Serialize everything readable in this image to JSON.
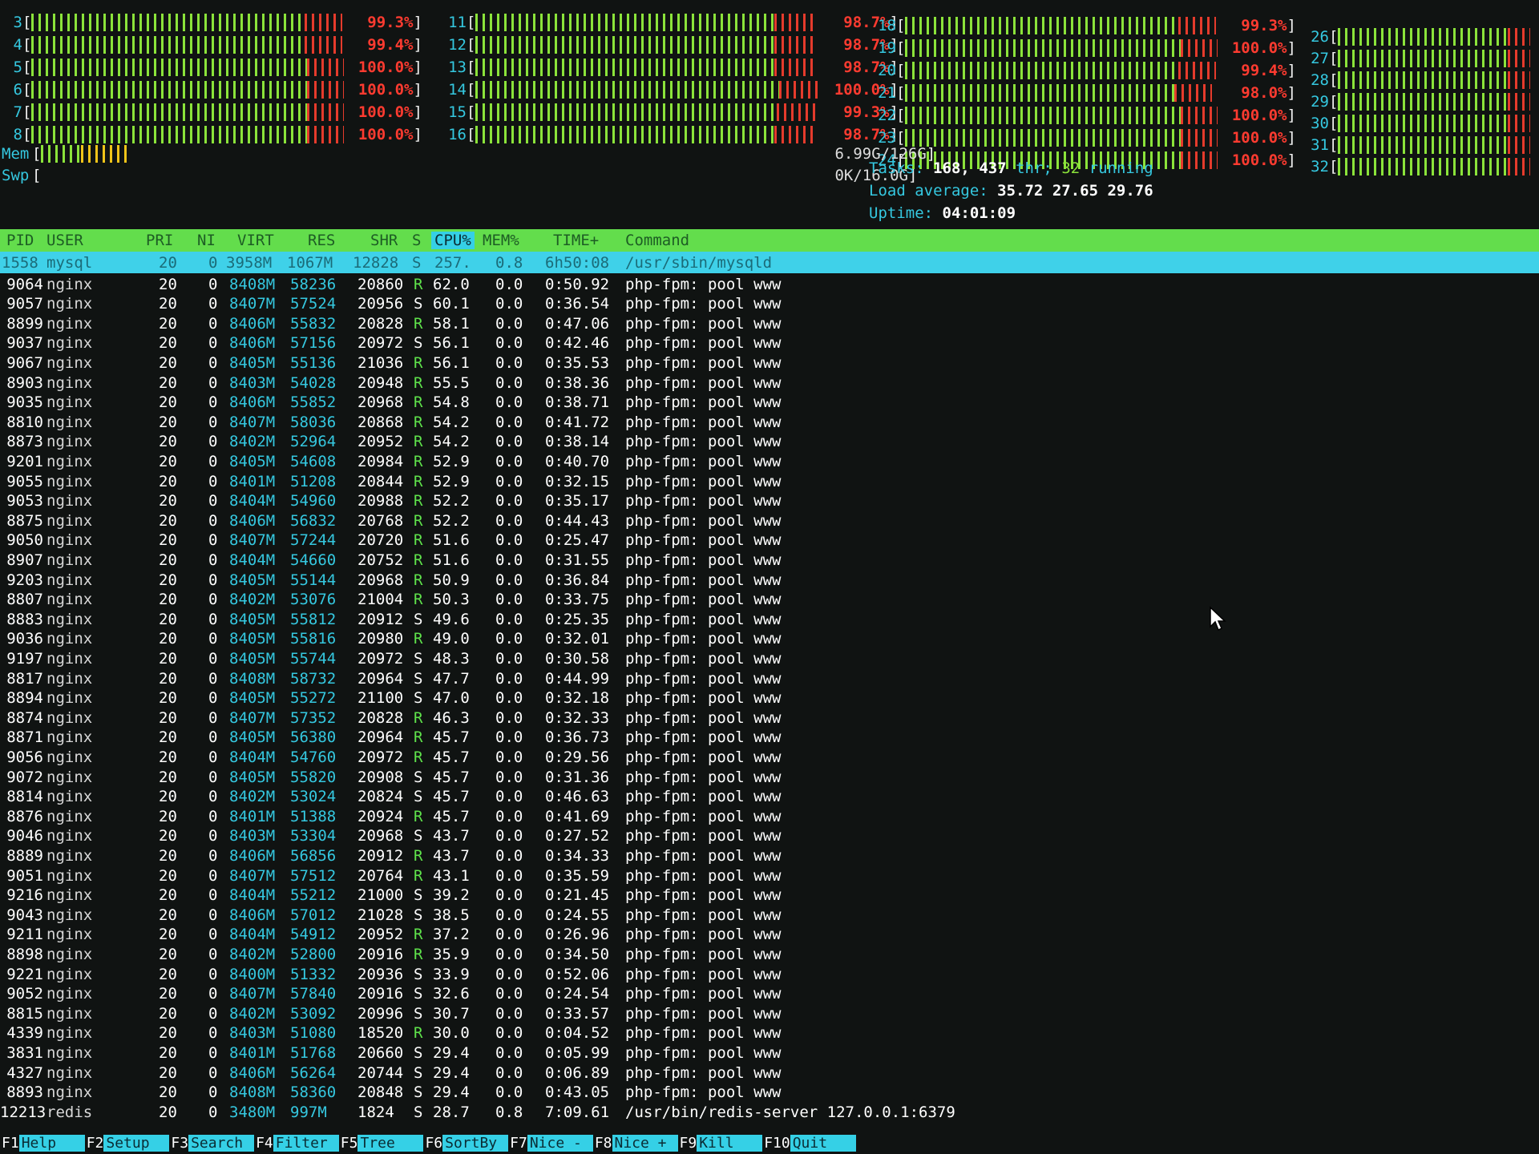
{
  "cpu_meters": [
    {
      "id": "3",
      "pct": "99.3%",
      "value": 0.993
    },
    {
      "id": "4",
      "pct": "99.4%",
      "value": 0.994
    },
    {
      "id": "5",
      "pct": "100.0%",
      "value": 1.0
    },
    {
      "id": "6",
      "pct": "100.0%",
      "value": 1.0
    },
    {
      "id": "7",
      "pct": "100.0%",
      "value": 1.0
    },
    {
      "id": "8",
      "pct": "100.0%",
      "value": 1.0
    },
    {
      "id": "11",
      "pct": "98.7%",
      "value": 0.987
    },
    {
      "id": "12",
      "pct": "98.7%",
      "value": 0.987
    },
    {
      "id": "13",
      "pct": "98.7%",
      "value": 0.987
    },
    {
      "id": "14",
      "pct": "100.0%",
      "value": 1.0
    },
    {
      "id": "15",
      "pct": "99.3%",
      "value": 0.993
    },
    {
      "id": "16",
      "pct": "98.7%",
      "value": 0.987
    },
    {
      "id": "18",
      "pct": "99.3%",
      "value": 0.993
    },
    {
      "id": "19",
      "pct": "100.0%",
      "value": 1.0
    },
    {
      "id": "20",
      "pct": "99.4%",
      "value": 0.994
    },
    {
      "id": "21",
      "pct": "98.0%",
      "value": 0.98
    },
    {
      "id": "22",
      "pct": "100.0%",
      "value": 1.0
    },
    {
      "id": "23",
      "pct": "100.0%",
      "value": 1.0
    },
    {
      "id": "24",
      "pct": "100.0%",
      "value": 1.0
    },
    {
      "id": "26",
      "pct": "",
      "value": 1.0
    },
    {
      "id": "27",
      "pct": "",
      "value": 1.0
    },
    {
      "id": "28",
      "pct": "",
      "value": 1.0
    },
    {
      "id": "29",
      "pct": "",
      "value": 1.0
    },
    {
      "id": "30",
      "pct": "",
      "value": 1.0
    },
    {
      "id": "31",
      "pct": "",
      "value": 1.0
    },
    {
      "id": "32",
      "pct": "",
      "value": 1.0
    }
  ],
  "mem": {
    "label": "Mem",
    "used": "6.99G/126G",
    "fill_green": 0.05,
    "fill_yellow": 0.06
  },
  "swap": {
    "label": "Swp",
    "used": "0K/16.0G"
  },
  "summary": {
    "tasks_label": "Tasks:",
    "tasks": "168,",
    "threads": "437",
    "thr_label": "thr;",
    "running": "32",
    "running_label": "running",
    "load_label": "Load average:",
    "load1": "35.72",
    "load5": "27.65",
    "load15": "29.76",
    "uptime_label": "Uptime:",
    "uptime": "04:01:09"
  },
  "columns": {
    "pid": "PID",
    "user": "USER",
    "pri": "PRI",
    "ni": "NI",
    "virt": "VIRT",
    "res": "RES",
    "shr": "SHR",
    "s": "S",
    "cpu": "CPU%",
    "mem": "MEM%",
    "time": "TIME+",
    "cmd": "Command"
  },
  "selected": {
    "pid": "1558",
    "user": "mysql",
    "pri": "20",
    "ni": "0",
    "virt": "3958M",
    "res": "1067M",
    "shr": "12828",
    "s": "S",
    "cpu": "257.",
    "mem": "0.8",
    "time": "6h50:08",
    "cmd": "/usr/sbin/mysqld"
  },
  "processes": [
    [
      "9064",
      "nginx",
      "20",
      "0",
      "8408M",
      "58236",
      "20860",
      "R",
      "62.0",
      "0.0",
      "0:50.92",
      "php-fpm: pool www"
    ],
    [
      "9057",
      "nginx",
      "20",
      "0",
      "8407M",
      "57524",
      "20956",
      "S",
      "60.1",
      "0.0",
      "0:36.54",
      "php-fpm: pool www"
    ],
    [
      "8899",
      "nginx",
      "20",
      "0",
      "8406M",
      "55832",
      "20828",
      "R",
      "58.1",
      "0.0",
      "0:47.06",
      "php-fpm: pool www"
    ],
    [
      "9037",
      "nginx",
      "20",
      "0",
      "8406M",
      "57156",
      "20972",
      "S",
      "56.1",
      "0.0",
      "0:42.46",
      "php-fpm: pool www"
    ],
    [
      "9067",
      "nginx",
      "20",
      "0",
      "8405M",
      "55136",
      "21036",
      "R",
      "56.1",
      "0.0",
      "0:35.53",
      "php-fpm: pool www"
    ],
    [
      "8903",
      "nginx",
      "20",
      "0",
      "8403M",
      "54028",
      "20948",
      "R",
      "55.5",
      "0.0",
      "0:38.36",
      "php-fpm: pool www"
    ],
    [
      "9035",
      "nginx",
      "20",
      "0",
      "8406M",
      "55852",
      "20968",
      "R",
      "54.8",
      "0.0",
      "0:38.71",
      "php-fpm: pool www"
    ],
    [
      "8810",
      "nginx",
      "20",
      "0",
      "8407M",
      "58036",
      "20868",
      "R",
      "54.2",
      "0.0",
      "0:41.72",
      "php-fpm: pool www"
    ],
    [
      "8873",
      "nginx",
      "20",
      "0",
      "8402M",
      "52964",
      "20952",
      "R",
      "54.2",
      "0.0",
      "0:38.14",
      "php-fpm: pool www"
    ],
    [
      "9201",
      "nginx",
      "20",
      "0",
      "8405M",
      "54608",
      "20984",
      "R",
      "52.9",
      "0.0",
      "0:40.70",
      "php-fpm: pool www"
    ],
    [
      "9055",
      "nginx",
      "20",
      "0",
      "8401M",
      "51208",
      "20844",
      "R",
      "52.9",
      "0.0",
      "0:32.15",
      "php-fpm: pool www"
    ],
    [
      "9053",
      "nginx",
      "20",
      "0",
      "8404M",
      "54960",
      "20988",
      "R",
      "52.2",
      "0.0",
      "0:35.17",
      "php-fpm: pool www"
    ],
    [
      "8875",
      "nginx",
      "20",
      "0",
      "8406M",
      "56832",
      "20768",
      "R",
      "52.2",
      "0.0",
      "0:44.43",
      "php-fpm: pool www"
    ],
    [
      "9050",
      "nginx",
      "20",
      "0",
      "8407M",
      "57244",
      "20720",
      "R",
      "51.6",
      "0.0",
      "0:25.47",
      "php-fpm: pool www"
    ],
    [
      "8907",
      "nginx",
      "20",
      "0",
      "8404M",
      "54660",
      "20752",
      "R",
      "51.6",
      "0.0",
      "0:31.55",
      "php-fpm: pool www"
    ],
    [
      "9203",
      "nginx",
      "20",
      "0",
      "8405M",
      "55144",
      "20968",
      "R",
      "50.9",
      "0.0",
      "0:36.84",
      "php-fpm: pool www"
    ],
    [
      "8807",
      "nginx",
      "20",
      "0",
      "8402M",
      "53076",
      "21004",
      "R",
      "50.3",
      "0.0",
      "0:33.75",
      "php-fpm: pool www"
    ],
    [
      "8883",
      "nginx",
      "20",
      "0",
      "8405M",
      "55812",
      "20912",
      "S",
      "49.6",
      "0.0",
      "0:25.35",
      "php-fpm: pool www"
    ],
    [
      "9036",
      "nginx",
      "20",
      "0",
      "8405M",
      "55816",
      "20980",
      "R",
      "49.0",
      "0.0",
      "0:32.01",
      "php-fpm: pool www"
    ],
    [
      "9197",
      "nginx",
      "20",
      "0",
      "8405M",
      "55744",
      "20972",
      "S",
      "48.3",
      "0.0",
      "0:30.58",
      "php-fpm: pool www"
    ],
    [
      "8817",
      "nginx",
      "20",
      "0",
      "8408M",
      "58732",
      "20964",
      "S",
      "47.7",
      "0.0",
      "0:44.99",
      "php-fpm: pool www"
    ],
    [
      "8894",
      "nginx",
      "20",
      "0",
      "8405M",
      "55272",
      "21100",
      "S",
      "47.0",
      "0.0",
      "0:32.18",
      "php-fpm: pool www"
    ],
    [
      "8874",
      "nginx",
      "20",
      "0",
      "8407M",
      "57352",
      "20828",
      "R",
      "46.3",
      "0.0",
      "0:32.33",
      "php-fpm: pool www"
    ],
    [
      "8871",
      "nginx",
      "20",
      "0",
      "8405M",
      "56380",
      "20964",
      "R",
      "45.7",
      "0.0",
      "0:36.73",
      "php-fpm: pool www"
    ],
    [
      "9056",
      "nginx",
      "20",
      "0",
      "8404M",
      "54760",
      "20972",
      "R",
      "45.7",
      "0.0",
      "0:29.56",
      "php-fpm: pool www"
    ],
    [
      "9072",
      "nginx",
      "20",
      "0",
      "8405M",
      "55820",
      "20908",
      "S",
      "45.7",
      "0.0",
      "0:31.36",
      "php-fpm: pool www"
    ],
    [
      "8814",
      "nginx",
      "20",
      "0",
      "8402M",
      "53024",
      "20824",
      "S",
      "45.7",
      "0.0",
      "0:46.63",
      "php-fpm: pool www"
    ],
    [
      "8876",
      "nginx",
      "20",
      "0",
      "8401M",
      "51388",
      "20924",
      "R",
      "45.7",
      "0.0",
      "0:41.69",
      "php-fpm: pool www"
    ],
    [
      "9046",
      "nginx",
      "20",
      "0",
      "8403M",
      "53304",
      "20968",
      "S",
      "43.7",
      "0.0",
      "0:27.52",
      "php-fpm: pool www"
    ],
    [
      "8889",
      "nginx",
      "20",
      "0",
      "8406M",
      "56856",
      "20912",
      "R",
      "43.7",
      "0.0",
      "0:34.33",
      "php-fpm: pool www"
    ],
    [
      "9051",
      "nginx",
      "20",
      "0",
      "8407M",
      "57512",
      "20764",
      "R",
      "43.1",
      "0.0",
      "0:35.59",
      "php-fpm: pool www"
    ],
    [
      "9216",
      "nginx",
      "20",
      "0",
      "8404M",
      "55212",
      "21000",
      "S",
      "39.2",
      "0.0",
      "0:21.45",
      "php-fpm: pool www"
    ],
    [
      "9043",
      "nginx",
      "20",
      "0",
      "8406M",
      "57012",
      "21028",
      "S",
      "38.5",
      "0.0",
      "0:24.55",
      "php-fpm: pool www"
    ],
    [
      "9211",
      "nginx",
      "20",
      "0",
      "8404M",
      "54912",
      "20952",
      "R",
      "37.2",
      "0.0",
      "0:26.96",
      "php-fpm: pool www"
    ],
    [
      "8898",
      "nginx",
      "20",
      "0",
      "8402M",
      "52800",
      "20916",
      "R",
      "35.9",
      "0.0",
      "0:34.50",
      "php-fpm: pool www"
    ],
    [
      "9221",
      "nginx",
      "20",
      "0",
      "8400M",
      "51332",
      "20936",
      "S",
      "33.9",
      "0.0",
      "0:52.06",
      "php-fpm: pool www"
    ],
    [
      "9052",
      "nginx",
      "20",
      "0",
      "8407M",
      "57840",
      "20916",
      "S",
      "32.6",
      "0.0",
      "0:24.54",
      "php-fpm: pool www"
    ],
    [
      "8815",
      "nginx",
      "20",
      "0",
      "8402M",
      "53092",
      "20996",
      "S",
      "30.7",
      "0.0",
      "0:33.57",
      "php-fpm: pool www"
    ],
    [
      "4339",
      "nginx",
      "20",
      "0",
      "8403M",
      "51080",
      "18520",
      "R",
      "30.0",
      "0.0",
      "0:04.52",
      "php-fpm: pool www"
    ],
    [
      "3831",
      "nginx",
      "20",
      "0",
      "8401M",
      "51768",
      "20660",
      "S",
      "29.4",
      "0.0",
      "0:05.99",
      "php-fpm: pool www"
    ],
    [
      "4327",
      "nginx",
      "20",
      "0",
      "8406M",
      "56264",
      "20744",
      "S",
      "29.4",
      "0.0",
      "0:06.89",
      "php-fpm: pool www"
    ],
    [
      "8893",
      "nginx",
      "20",
      "0",
      "8408M",
      "58360",
      "20848",
      "S",
      "29.4",
      "0.0",
      "0:43.05",
      "php-fpm: pool www"
    ],
    [
      "12213",
      "redis",
      "20",
      "0",
      "3480M",
      "997M",
      "1824",
      "S",
      "28.7",
      "0.8",
      "7:09.61",
      "/usr/bin/redis-server 127.0.0.1:6379"
    ]
  ],
  "fkeys": [
    {
      "key": "F1",
      "label": "Help"
    },
    {
      "key": "F2",
      "label": "Setup"
    },
    {
      "key": "F3",
      "label": "Search"
    },
    {
      "key": "F4",
      "label": "Filter"
    },
    {
      "key": "F5",
      "label": "Tree"
    },
    {
      "key": "F6",
      "label": "SortBy"
    },
    {
      "key": "F7",
      "label": "Nice -"
    },
    {
      "key": "F8",
      "label": "Nice +"
    },
    {
      "key": "F9",
      "label": "Kill"
    },
    {
      "key": "F10",
      "label": "Quit"
    }
  ]
}
